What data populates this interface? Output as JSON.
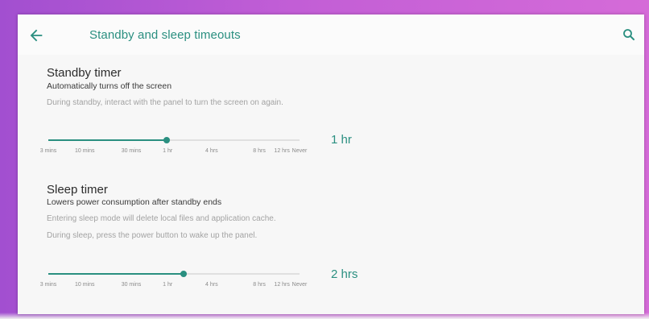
{
  "header": {
    "title": "Standby and sleep timeouts",
    "back_icon": "arrow-left-icon",
    "search_icon": "search-icon"
  },
  "accent_color": "#2a8f80",
  "tick_labels": [
    "3 mins",
    "10 mins",
    "30 mins",
    "1 hr",
    "4 hrs",
    "8 hrs",
    "12 hrs",
    "Never"
  ],
  "standby": {
    "title": "Standby timer",
    "subtitle": "Automatically turns off the screen",
    "desc1": "During standby, interact with the panel to turn the screen on again.",
    "value_label": "1 hr",
    "slider_fraction": 0.47
  },
  "sleep": {
    "title": "Sleep timer",
    "subtitle": "Lowers power consumption after standby ends",
    "desc1": "Entering sleep mode will delete local files and application cache.",
    "desc2": "During sleep, press the power button to wake up the panel.",
    "value_label": "2 hrs",
    "slider_fraction": 0.54
  }
}
